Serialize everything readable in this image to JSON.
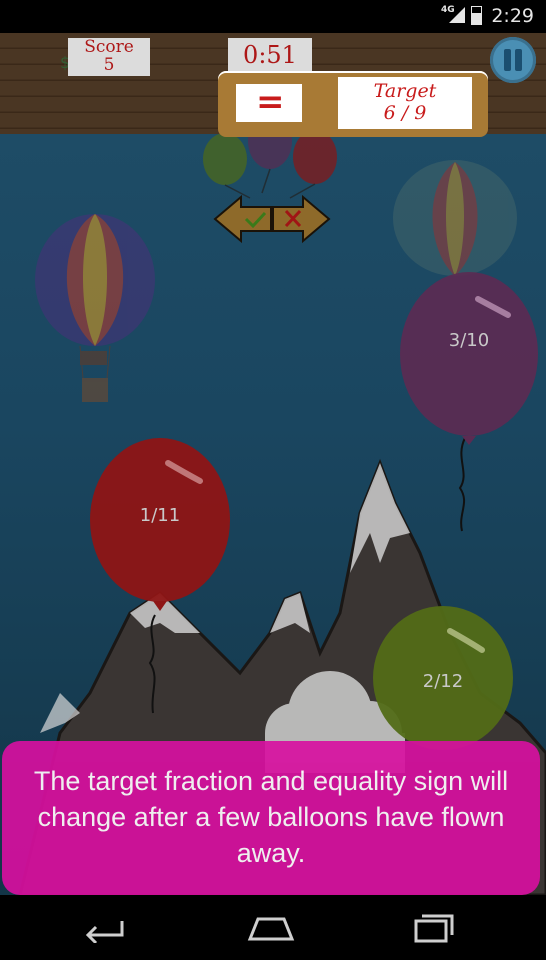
{
  "status_bar": {
    "network": "4G",
    "time": "2:29"
  },
  "hud": {
    "score_label": "Score",
    "score_value": "5",
    "timer": "0:51",
    "pause_icon": "pause-icon"
  },
  "target_panel": {
    "sign": "=",
    "target_label": "Target",
    "target_value": "6 / 9"
  },
  "controls": {
    "left_arrow_icon": "check-arrow-icon",
    "right_arrow_icon": "cross-arrow-icon"
  },
  "balloons": [
    {
      "label": "3/10",
      "color": "#5b2b52"
    },
    {
      "label": "1/11",
      "color": "#8e1515"
    },
    {
      "label": "2/12",
      "color": "#526b17"
    }
  ],
  "hint": {
    "text": "The target fraction and equality sign will change after a few balloons have flown away."
  },
  "nav": {
    "back_icon": "back-icon",
    "home_icon": "home-icon",
    "recents_icon": "recents-icon"
  }
}
